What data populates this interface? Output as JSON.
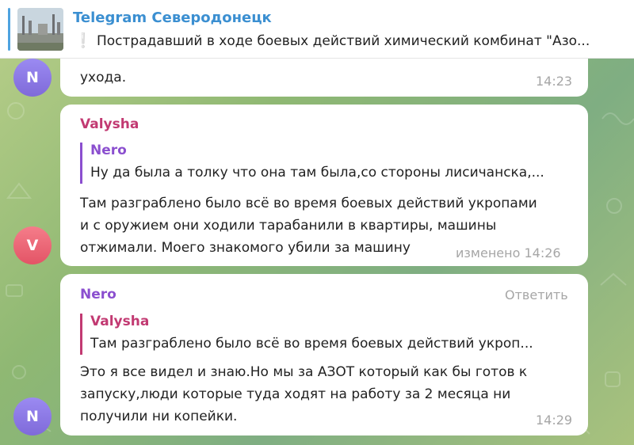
{
  "pinned": {
    "channel_title": "Telegram Северодонецк",
    "exclamation": "❕",
    "text": "Пострадавший в ходе боевых действий химический комбинат \"Азо..."
  },
  "messages": [
    {
      "avatar_letter": "N",
      "text_lines": [
        "ухода."
      ],
      "time": "14:23"
    },
    {
      "sender": "Valysha",
      "avatar_letter": "V",
      "reply": {
        "name": "Nero",
        "text": "Ну да была а толку что она там была,со стороны лисичанска,..."
      },
      "text_lines": [
        "Там разграблено было всё во время боевых действий укропами",
        "и с оружием они ходили тарабанили в квартиры, машины",
        "отжимали. Моего знакомого убили за машину"
      ],
      "time": "изменено 14:26"
    },
    {
      "sender": "Nero",
      "avatar_letter": "N",
      "reply_button": "Ответить",
      "reply": {
        "name": "Valysha",
        "text": "Там разграблено было всё во время боевых действий укроп..."
      },
      "text_lines": [
        "Это я все видел и знаю.Но мы за АЗОТ который как бы готов к",
        "запуску,люди которые туда ходят на работу за 2 месяца ни",
        "получили ни копейки."
      ],
      "time": "14:29"
    }
  ],
  "colors": {
    "accent": "#3b8fd1",
    "valysha": "#c23a72",
    "nero": "#8b4fcf",
    "avatar_n": "#8a74e6",
    "avatar_v": "#ee6778",
    "time": "#a6a6a6"
  },
  "icons": {
    "channel_thumbnail": "industrial-plant-thumbnail",
    "background": "doodle-pattern"
  }
}
